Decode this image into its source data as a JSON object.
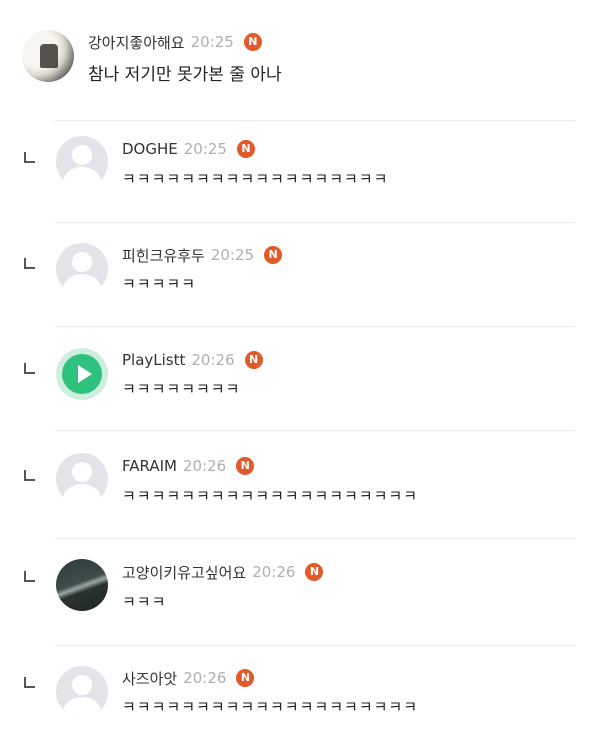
{
  "comments": [
    {
      "nickname": "강아지좋아해요",
      "time": "20:25",
      "badge": "N",
      "text": "참나 저기만 못가본 줄 아나",
      "avatar": "profile-photo"
    },
    {
      "nickname": "DOGHE",
      "time": "20:25",
      "badge": "N",
      "text": "ㅋㅋㅋㅋㅋㅋㅋㅋㅋㅋㅋㅋㅋㅋㅋㅋㅋㅋ",
      "avatar": "default-profile"
    },
    {
      "nickname": "피힌크유후두",
      "time": "20:25",
      "badge": "N",
      "text": "ㅋㅋㅋㅋㅋ",
      "avatar": "default-profile"
    },
    {
      "nickname": "PlayListt",
      "time": "20:26",
      "badge": "N",
      "text": "ㅋㅋㅋㅋㅋㅋㅋㅋ",
      "avatar": "play-icon"
    },
    {
      "nickname": "FARAIM",
      "time": "20:26",
      "badge": "N",
      "text": "ㅋㅋㅋㅋㅋㅋㅋㅋㅋㅋㅋㅋㅋㅋㅋㅋㅋㅋㅋㅋ",
      "avatar": "default-profile"
    },
    {
      "nickname": "고양이키유고싶어요",
      "time": "20:26",
      "badge": "N",
      "text": "ㅋㅋㅋ",
      "avatar": "profile-photo"
    },
    {
      "nickname": "사즈아앗",
      "time": "20:26",
      "badge": "N",
      "text": "ㅋㅋㅋㅋㅋㅋㅋㅋㅋㅋㅋㅋㅋㅋㅋㅋㅋㅋㅋㅋ",
      "avatar": "default-profile"
    }
  ],
  "colors": {
    "badge": "#e05a2a",
    "time": "#b0b0b0",
    "reply_marker": "#555555"
  }
}
